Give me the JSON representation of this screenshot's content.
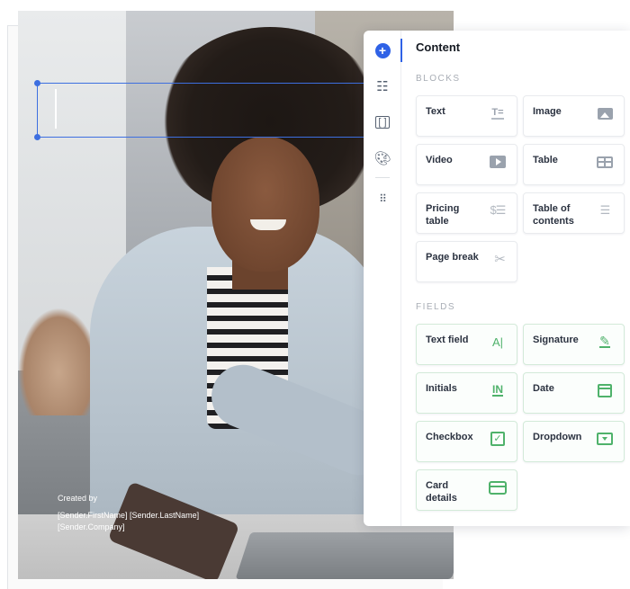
{
  "document": {
    "sender": {
      "created_by": "Created by",
      "name_fields": "[Sender.FirstName]  [Sender.LastName]",
      "company_field": "[Sender.Company]"
    }
  },
  "rail": {
    "items": [
      {
        "icon": "plus-circle-icon",
        "active": true
      },
      {
        "icon": "sliders-icon"
      },
      {
        "icon": "embed-code-icon"
      },
      {
        "icon": "palette-icon"
      },
      {
        "icon": "grid-apps-icon"
      }
    ]
  },
  "panel": {
    "title": "Content",
    "blocks_label": "BLOCKS",
    "fields_label": "FIELDS",
    "blocks": [
      {
        "label": "Text",
        "icon": "text-icon"
      },
      {
        "label": "Image",
        "icon": "image-icon"
      },
      {
        "label": "Video",
        "icon": "video-icon"
      },
      {
        "label": "Table",
        "icon": "table-icon"
      },
      {
        "label": "Pricing table",
        "icon": "pricing-table-icon",
        "icon_text": "$☰"
      },
      {
        "label": "Table of contents",
        "icon": "toc-icon",
        "icon_text": "☰"
      },
      {
        "label": "Page break",
        "icon": "scissors-icon",
        "icon_text": "✂"
      }
    ],
    "fields": [
      {
        "label": "Text field",
        "icon": "text-field-icon",
        "icon_text": "A|"
      },
      {
        "label": "Signature",
        "icon": "signature-icon",
        "icon_text": "✎"
      },
      {
        "label": "Initials",
        "icon": "initials-icon",
        "icon_text": "IN"
      },
      {
        "label": "Date",
        "icon": "calendar-icon"
      },
      {
        "label": "Checkbox",
        "icon": "checkbox-icon",
        "icon_text": "✓"
      },
      {
        "label": "Dropdown",
        "icon": "dropdown-icon"
      },
      {
        "label": "Card details",
        "icon": "card-icon"
      }
    ]
  },
  "colors": {
    "accent": "#2f62e6",
    "field_green": "#4fb26b",
    "selection_blue": "#3d6fe0"
  }
}
